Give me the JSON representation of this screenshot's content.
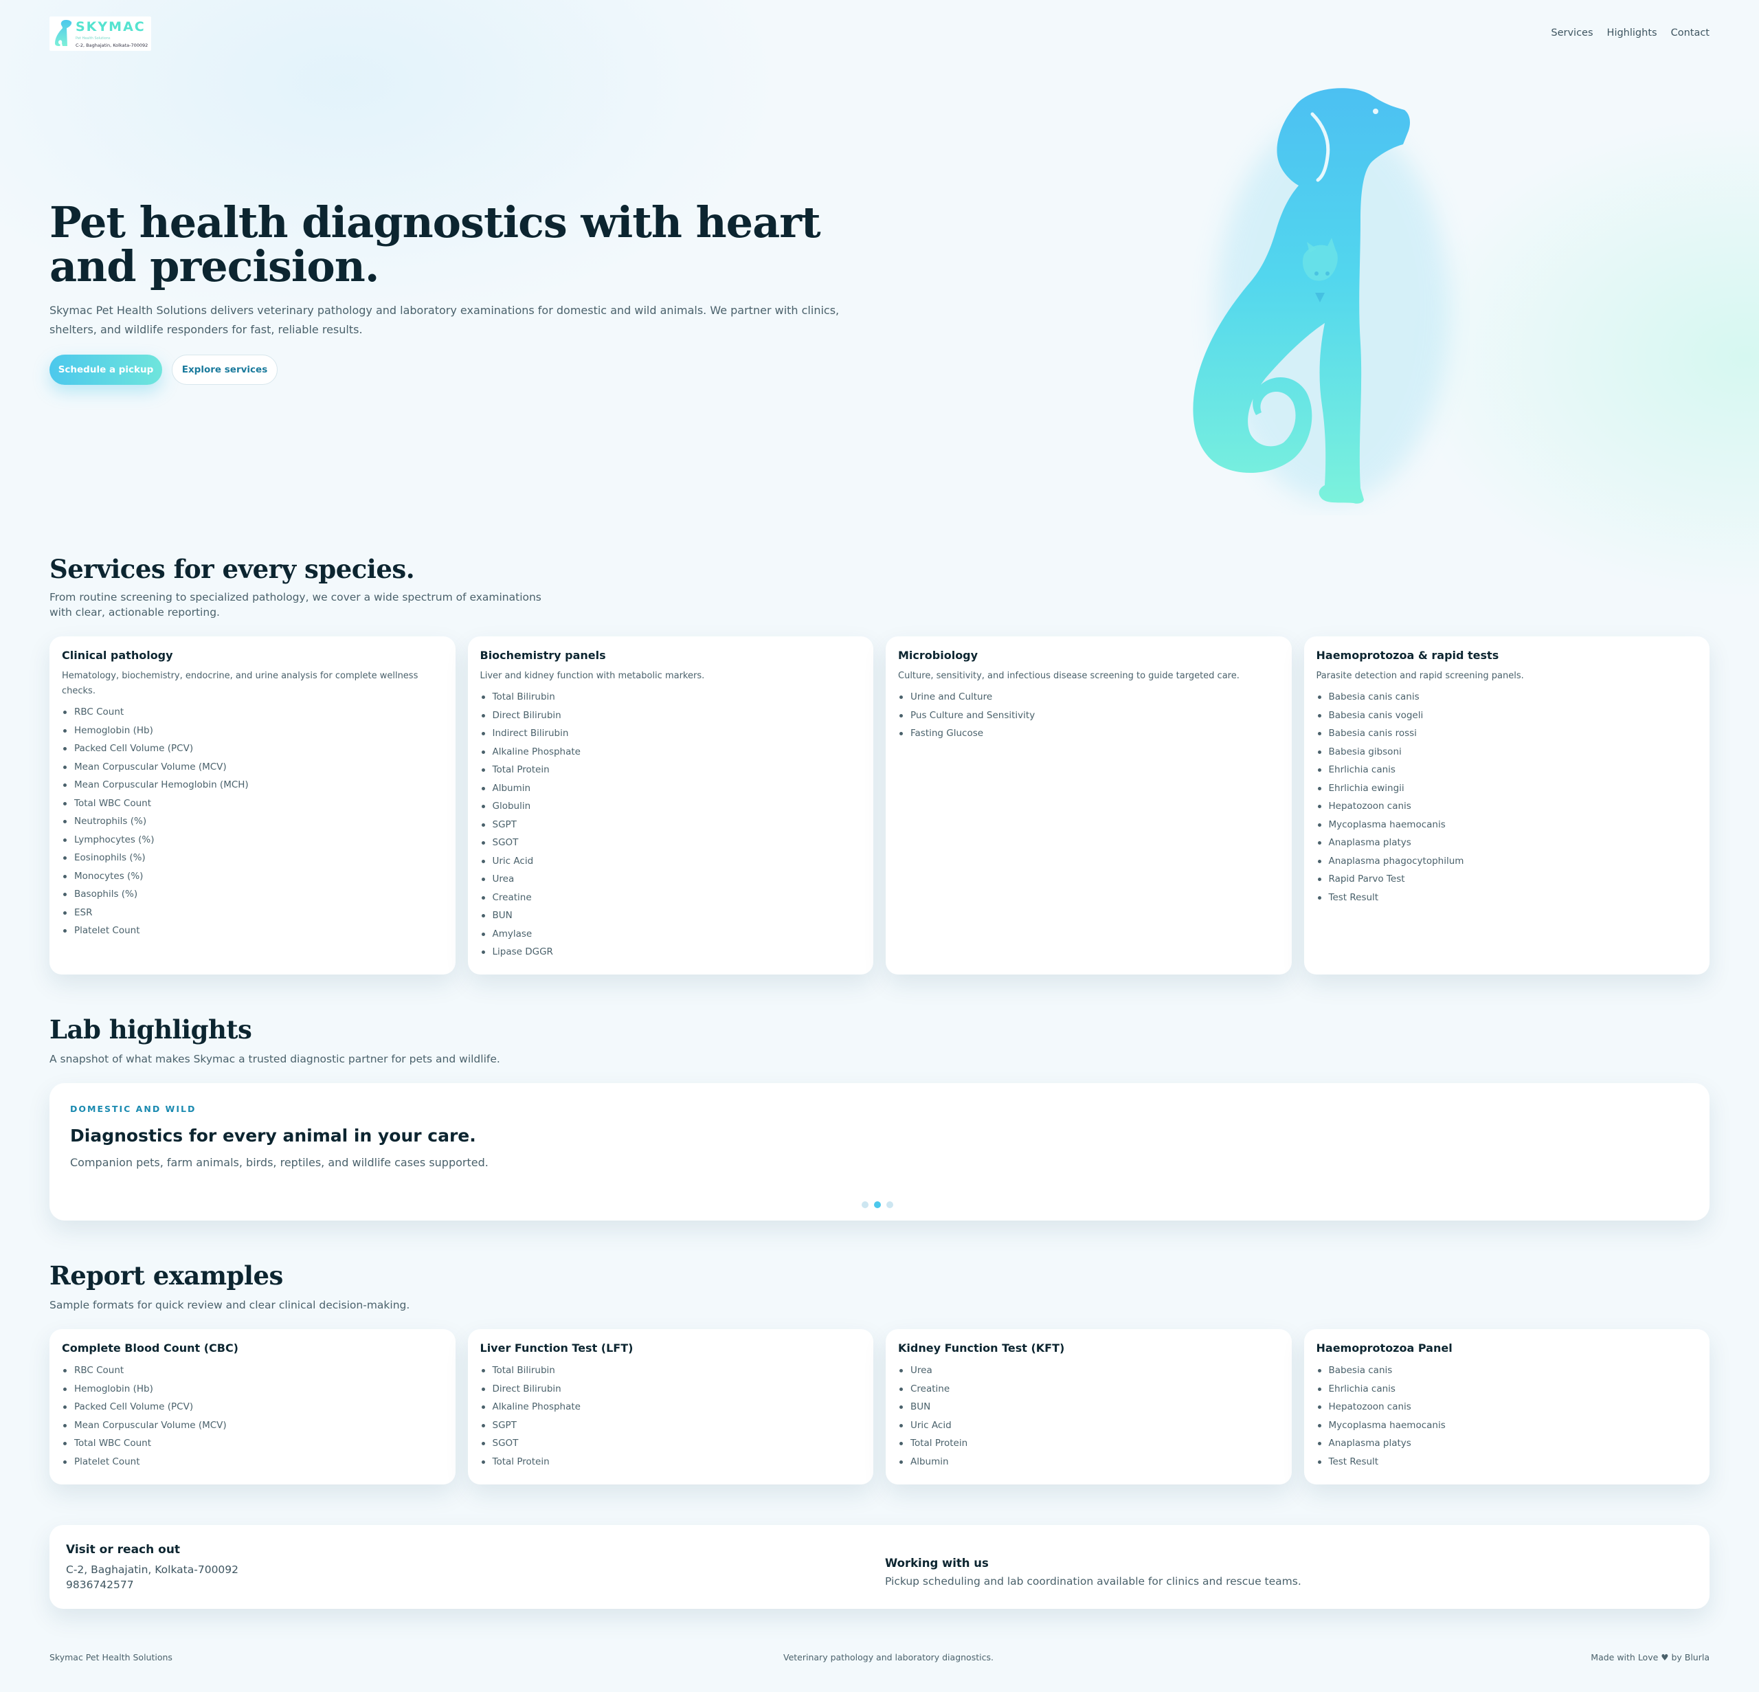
{
  "header": {
    "logo": {
      "brand": "SKYMAC",
      "tagline": "Pet Health Solutions",
      "address": "C-2, Baghajatin, Kolkata-700092"
    },
    "nav": [
      "Services",
      "Highlights",
      "Contact"
    ]
  },
  "hero": {
    "title": "Pet health diagnostics with heart and precision.",
    "subtitle": "Skymac Pet Health Solutions delivers veterinary pathology and laboratory examinations for domestic and wild animals. We partner with clinics, shelters, and wildlife responders for fast, reliable results.",
    "primary_cta": "Schedule a pickup",
    "secondary_cta": "Explore services",
    "art_icon": "dog-cat-silhouette-icon"
  },
  "services": {
    "title": "Services for every species.",
    "subtitle": "From routine screening to specialized pathology, we cover a wide spectrum of examinations with clear, actionable reporting.",
    "cards": [
      {
        "title": "Clinical pathology",
        "desc": "Hematology, biochemistry, endocrine, and urine analysis for complete wellness checks.",
        "items": [
          "RBC Count",
          "Hemoglobin (Hb)",
          "Packed Cell Volume (PCV)",
          "Mean Corpuscular Volume (MCV)",
          "Mean Corpuscular Hemoglobin (MCH)",
          "Total WBC Count",
          "Neutrophils (%)",
          "Lymphocytes (%)",
          "Eosinophils (%)",
          "Monocytes (%)",
          "Basophils (%)",
          "ESR",
          "Platelet Count"
        ]
      },
      {
        "title": "Biochemistry panels",
        "desc": "Liver and kidney function with metabolic markers.",
        "items": [
          "Total Bilirubin",
          "Direct Bilirubin",
          "Indirect Bilirubin",
          "Alkaline Phosphate",
          "Total Protein",
          "Albumin",
          "Globulin",
          "SGPT",
          "SGOT",
          "Uric Acid",
          "Urea",
          "Creatine",
          "BUN",
          "Amylase",
          "Lipase DGGR"
        ]
      },
      {
        "title": "Microbiology",
        "desc": "Culture, sensitivity, and infectious disease screening to guide targeted care.",
        "items": [
          "Urine and Culture",
          "Pus Culture and Sensitivity",
          "Fasting Glucose"
        ]
      },
      {
        "title": "Haemoprotozoa & rapid tests",
        "desc": "Parasite detection and rapid screening panels.",
        "items": [
          "Babesia canis canis",
          "Babesia canis vogeli",
          "Babesia canis rossi",
          "Babesia gibsoni",
          "Ehrlichia canis",
          "Ehrlichia ewingii",
          "Hepatozoon canis",
          "Mycoplasma haemocanis",
          "Anaplasma platys",
          "Anaplasma phagocytophilum",
          "Rapid Parvo Test",
          "Test Result"
        ]
      }
    ]
  },
  "highlights": {
    "title": "Lab highlights",
    "subtitle": "A snapshot of what makes Skymac a trusted diagnostic partner for pets and wildlife.",
    "slide": {
      "kicker": "DOMESTIC AND WILD",
      "title": "Diagnostics for every animal in your care.",
      "body": "Companion pets, farm animals, birds, reptiles, and wildlife cases supported."
    },
    "slide_count": 3,
    "active_index": 1
  },
  "reports": {
    "title": "Report examples",
    "subtitle": "Sample formats for quick review and clear clinical decision-making.",
    "cards": [
      {
        "title": "Complete Blood Count (CBC)",
        "items": [
          "RBC Count",
          "Hemoglobin (Hb)",
          "Packed Cell Volume (PCV)",
          "Mean Corpuscular Volume (MCV)",
          "Total WBC Count",
          "Platelet Count"
        ]
      },
      {
        "title": "Liver Function Test (LFT)",
        "items": [
          "Total Bilirubin",
          "Direct Bilirubin",
          "Alkaline Phosphate",
          "SGPT",
          "SGOT",
          "Total Protein"
        ]
      },
      {
        "title": "Kidney Function Test (KFT)",
        "items": [
          "Urea",
          "Creatine",
          "BUN",
          "Uric Acid",
          "Total Protein",
          "Albumin"
        ]
      },
      {
        "title": "Haemoprotozoa Panel",
        "items": [
          "Babesia canis",
          "Ehrlichia canis",
          "Hepatozoon canis",
          "Mycoplasma haemocanis",
          "Anaplasma platys",
          "Test Result"
        ]
      }
    ]
  },
  "contact": {
    "title": "Visit or reach out",
    "address": "C-2, Baghajatin, Kolkata-700092",
    "phone": "9836742577",
    "work_title": "Working with us",
    "work_body": "Pickup scheduling and lab coordination available for clinics and rescue teams."
  },
  "footer": {
    "left": "Skymac Pet Health Solutions",
    "center": "Veterinary pathology and laboratory diagnostics.",
    "right": "Made with Love ♥ by Blurla"
  },
  "colors": {
    "accent": "#4cc8ec",
    "accent2": "#6fe5dc",
    "heading": "#0c2530",
    "body": "#4a616b",
    "kicker": "#1a8ab0"
  }
}
